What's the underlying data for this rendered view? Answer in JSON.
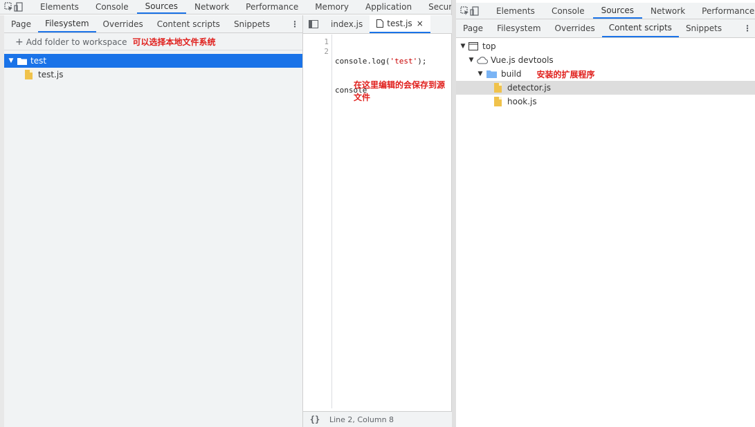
{
  "left_devtools": {
    "main_tabs": [
      "Elements",
      "Console",
      "Sources",
      "Network",
      "Performance",
      "Memory",
      "Application",
      "Security"
    ],
    "active_main_tab": "Sources",
    "navigator_tabs": [
      "Page",
      "Filesystem",
      "Overrides",
      "Content scripts",
      "Snippets"
    ],
    "active_navigator_tab": "Filesystem",
    "add_folder_label": "Add folder to workspace",
    "annotation_filesystem": "可以选择本地文件系统",
    "tree": {
      "folder": "test",
      "file": "test.js"
    },
    "editor": {
      "tabs": [
        "index.js",
        "test.js"
      ],
      "active_tab": "test.js",
      "close_glyph": "×",
      "line_numbers": [
        "1",
        "2"
      ],
      "code_lines": [
        "console.log('test');",
        "console"
      ],
      "annotation": "在这里编辑的会保存到源文件",
      "status_braces": "{}",
      "status_position": "Line 2, Column 8"
    }
  },
  "right_devtools": {
    "main_tabs": [
      "Elements",
      "Console",
      "Sources",
      "Network",
      "Performance"
    ],
    "active_main_tab": "Sources",
    "navigator_tabs": [
      "Page",
      "Filesystem",
      "Overrides",
      "Content scripts",
      "Snippets"
    ],
    "active_navigator_tab": "Content scripts",
    "tree": {
      "top": "top",
      "extension": "Vue.js devtools",
      "folder": "build",
      "files": [
        "detector.js",
        "hook.js"
      ]
    },
    "annotation_extension": "安装的扩展程序"
  },
  "colors": {
    "accent": "#1a73e8",
    "annotation_red": "#e0201d",
    "toolbar_bg": "#f1f3f4",
    "file_icon": "#f0c24b",
    "folder_icon_blue": "#7ab4f5"
  },
  "icons": {
    "inspect": "inspect-element-icon",
    "device": "device-toolbar-icon",
    "kebab": "more-options-icon",
    "sidebar_toggle": "toggle-navigator-icon",
    "file": "file-icon",
    "folder": "folder-icon",
    "cloud": "cloud-icon",
    "frame": "frame-icon",
    "plus": "plus-icon"
  }
}
